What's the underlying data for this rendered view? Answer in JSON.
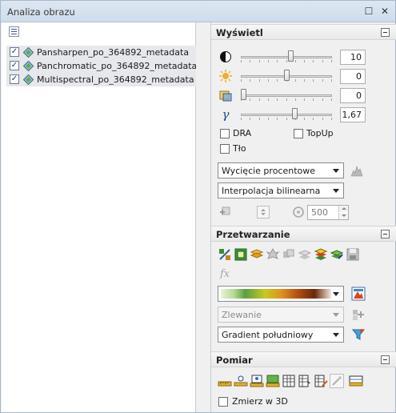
{
  "window": {
    "title": "Analiza obrazu",
    "restore_glyph": "☐",
    "close_glyph": "✕"
  },
  "layers": [
    {
      "name": "Pansharpen_po_364892_metadata",
      "checked": true
    },
    {
      "name": "Panchromatic_po_364892_metadata",
      "checked": true
    },
    {
      "name": "Multispectral_po_364892_metadata",
      "checked": true
    }
  ],
  "display": {
    "title": "Wyświetl",
    "sliders": [
      {
        "icon": "contrast-icon",
        "value": "10",
        "level": 0.55
      },
      {
        "icon": "brightness-icon",
        "value": "0",
        "level": 0.5
      },
      {
        "icon": "transparency-icon",
        "value": "0",
        "level": 0.0
      },
      {
        "icon": "gamma-icon",
        "value": "1,67",
        "level": 0.6
      }
    ],
    "gamma_glyph": "γ",
    "checkboxes": {
      "dra": "DRA",
      "topup": "TopUp",
      "background": "Tło"
    },
    "stretch_type": "Wycięcie procentowe",
    "resampling": "Interpolacja bilinearna",
    "spin_value": "500"
  },
  "processing": {
    "title": "Przetwarzanie",
    "blend_mode": "Zlewanie",
    "colormap": "Gradient południowy"
  },
  "measure": {
    "title": "Pomiar",
    "measure_3d": "Zmierz w 3D"
  },
  "colors": {
    "accent": "#3a6ea5",
    "header_bg": "#dde7f2"
  }
}
